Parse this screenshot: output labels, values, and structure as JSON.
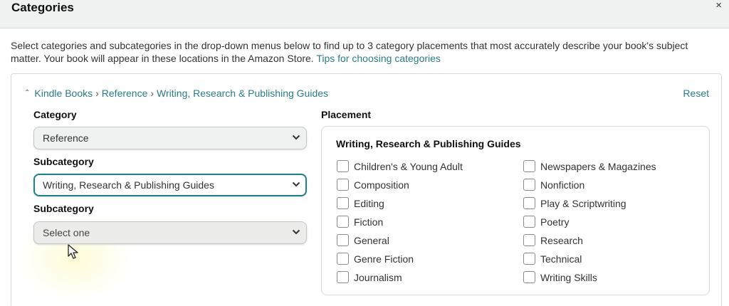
{
  "header": {
    "title": "Categories",
    "close": "×"
  },
  "intro": {
    "text": "Select categories and subcategories in the drop-down menus below to find up to 3 category placements that most accurately describe your book's subject matter. Your book will appear in these locations in the Amazon Store.",
    "link": "Tips for choosing categories"
  },
  "breadcrumb": {
    "items": [
      "Kindle Books",
      "Reference",
      "Writing, Research & Publishing Guides"
    ],
    "separator": "›"
  },
  "reset_label": "Reset",
  "fields": [
    {
      "label": "Category",
      "value": "Reference"
    },
    {
      "label": "Subcategory",
      "value": "Writing, Research & Publishing Guides"
    },
    {
      "label": "Subcategory",
      "value": "Select one"
    }
  ],
  "placement": {
    "label": "Placement",
    "title": "Writing, Research & Publishing Guides",
    "left_options": [
      "Children's & Young Adult",
      "Composition",
      "Editing",
      "Fiction",
      "General",
      "Genre Fiction",
      "Journalism"
    ],
    "right_options": [
      "Newspapers & Magazines",
      "Nonfiction",
      "Play & Scriptwriting",
      "Poetry",
      "Research",
      "Technical",
      "Writing Skills"
    ]
  },
  "colors": {
    "link": "#2a7c8a",
    "focus_border": "#1f7e8c",
    "header_bg": "#f0f2f2"
  }
}
